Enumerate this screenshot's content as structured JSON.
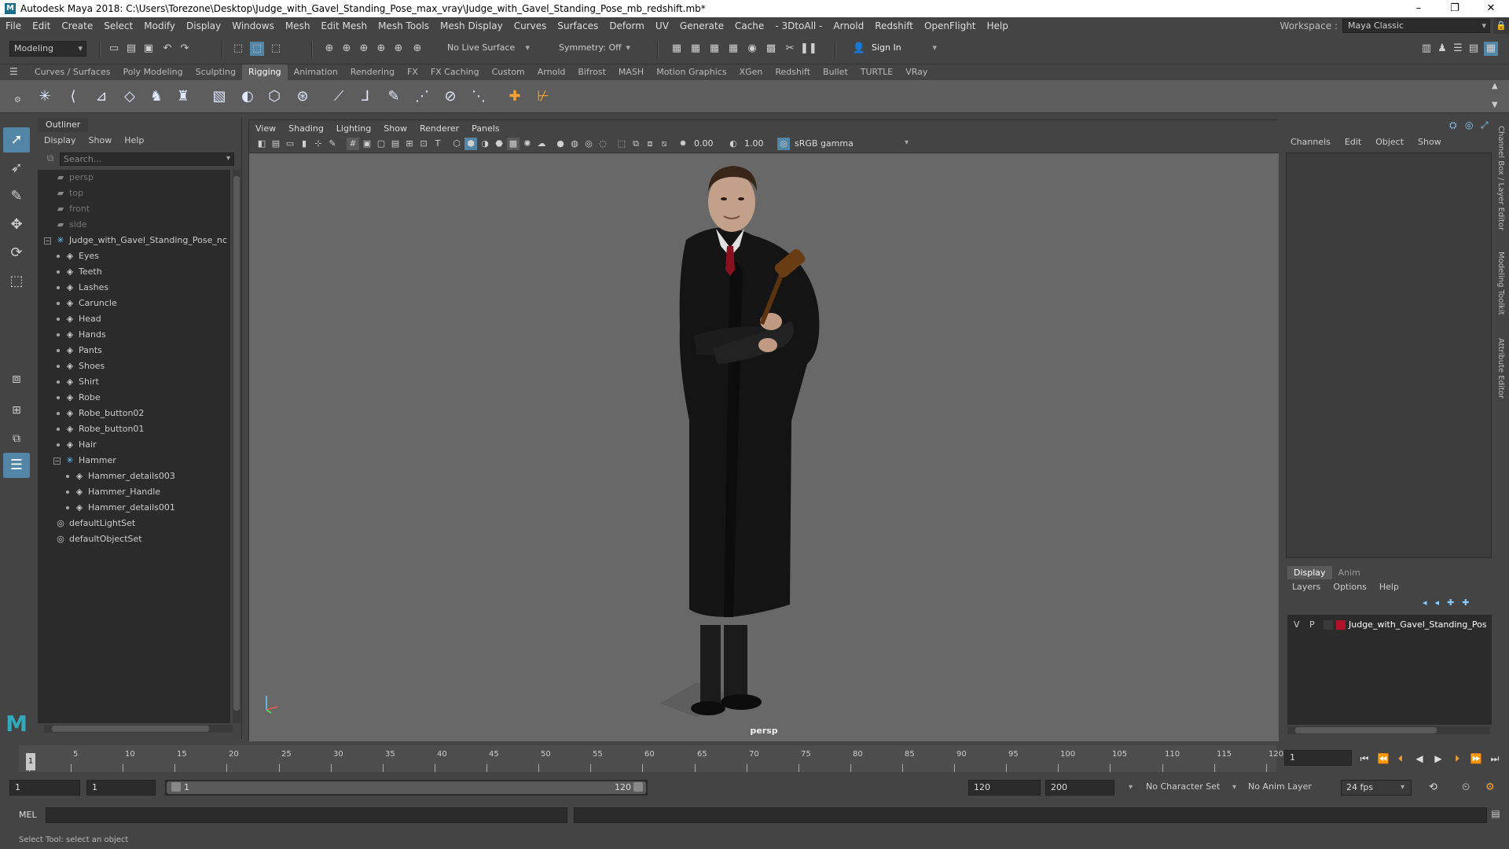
{
  "window": {
    "title": "Autodesk Maya 2018: C:\\Users\\Torezone\\Desktop\\Judge_with_Gavel_Standing_Pose_max_vray\\Judge_with_Gavel_Standing_Pose_mb_redshift.mb*",
    "logo": "M",
    "min": "–",
    "max": "❐",
    "close": "✕"
  },
  "menubar": {
    "items": [
      "File",
      "Edit",
      "Create",
      "Select",
      "Modify",
      "Display",
      "Windows",
      "Mesh",
      "Edit Mesh",
      "Mesh Tools",
      "Mesh Display",
      "Curves",
      "Surfaces",
      "Deform",
      "UV",
      "Generate",
      "Cache",
      "- 3DtoAll -",
      "Arnold",
      "Redshift",
      "OpenFlight",
      "Help"
    ],
    "workspace_label": "Workspace :",
    "workspace_value": "Maya Classic",
    "lock_icon": "🔒"
  },
  "statusline": {
    "mode": "Modeling",
    "live_surface": "No Live Surface",
    "symmetry": "Symmetry: Off",
    "sign_in": "Sign In"
  },
  "shelf": {
    "tabs": [
      "Curves / Surfaces",
      "Poly Modeling",
      "Sculpting",
      "Rigging",
      "Animation",
      "Rendering",
      "FX",
      "FX Caching",
      "Custom",
      "Arnold",
      "Bifrost",
      "MASH",
      "Motion Graphics",
      "XGen",
      "Redshift",
      "Bullet",
      "TURTLE",
      "VRay"
    ],
    "active_tab": "Rigging"
  },
  "outliner": {
    "title": "Outliner",
    "menu": [
      "Display",
      "Show",
      "Help"
    ],
    "search_placeholder": "Search...",
    "rows": [
      {
        "label": "persp",
        "indent": 0,
        "type": "camera",
        "dim": true
      },
      {
        "label": "top",
        "indent": 0,
        "type": "camera",
        "dim": true
      },
      {
        "label": "front",
        "indent": 0,
        "type": "camera",
        "dim": true
      },
      {
        "label": "side",
        "indent": 0,
        "type": "camera",
        "dim": true
      },
      {
        "label": "Judge_with_Gavel_Standing_Pose_nc",
        "indent": 0,
        "type": "joint",
        "expand": "−"
      },
      {
        "label": "Eyes",
        "indent": 1,
        "type": "mesh"
      },
      {
        "label": "Teeth",
        "indent": 1,
        "type": "mesh"
      },
      {
        "label": "Lashes",
        "indent": 1,
        "type": "mesh"
      },
      {
        "label": "Caruncle",
        "indent": 1,
        "type": "mesh"
      },
      {
        "label": "Head",
        "indent": 1,
        "type": "mesh"
      },
      {
        "label": "Hands",
        "indent": 1,
        "type": "mesh"
      },
      {
        "label": "Pants",
        "indent": 1,
        "type": "mesh"
      },
      {
        "label": "Shoes",
        "indent": 1,
        "type": "mesh"
      },
      {
        "label": "Shirt",
        "indent": 1,
        "type": "mesh"
      },
      {
        "label": "Robe",
        "indent": 1,
        "type": "mesh"
      },
      {
        "label": "Robe_button02",
        "indent": 1,
        "type": "mesh"
      },
      {
        "label": "Robe_button01",
        "indent": 1,
        "type": "mesh"
      },
      {
        "label": "Hair",
        "indent": 1,
        "type": "mesh"
      },
      {
        "label": "Hammer",
        "indent": 1,
        "type": "joint",
        "expand": "−"
      },
      {
        "label": "Hammer_details003",
        "indent": 2,
        "type": "mesh"
      },
      {
        "label": "Hammer_Handle",
        "indent": 2,
        "type": "mesh"
      },
      {
        "label": "Hammer_details001",
        "indent": 2,
        "type": "mesh"
      },
      {
        "label": "defaultLightSet",
        "indent": 0,
        "type": "set"
      },
      {
        "label": "defaultObjectSet",
        "indent": 0,
        "type": "set"
      }
    ]
  },
  "viewport": {
    "menu": [
      "View",
      "Shading",
      "Lighting",
      "Show",
      "Renderer",
      "Panels"
    ],
    "exposure": "0.00",
    "gamma": "1.00",
    "color_space": "sRGB gamma",
    "camera_label": "persp"
  },
  "channelbox": {
    "menu": [
      "Channels",
      "Edit",
      "Object",
      "Show"
    ],
    "layer_tabs": [
      "Display",
      "Anim"
    ],
    "layer_menu": [
      "Layers",
      "Options",
      "Help"
    ],
    "layer_row": {
      "v": "V",
      "p": "P",
      "name": "Judge_with_Gavel_Standing_Pos",
      "color": "#b0102a"
    }
  },
  "side_tabs": [
    "Channel Box / Layer Editor",
    "Modeling Toolkit",
    "Attribute Editor"
  ],
  "timeline": {
    "ticks": [
      1,
      5,
      10,
      15,
      20,
      25,
      30,
      35,
      40,
      45,
      50,
      55,
      60,
      65,
      70,
      75,
      80,
      85,
      90,
      95,
      100,
      105,
      110,
      115,
      120
    ],
    "current_frame": "1",
    "current_marker": "1"
  },
  "range": {
    "start": "1",
    "playback_start": "1",
    "slider_start": "1",
    "slider_end": "120",
    "playback_end": "120",
    "end": "200",
    "character_set": "No Character Set",
    "anim_layer": "No Anim Layer",
    "fps": "24 fps"
  },
  "cmd": {
    "lang": "MEL"
  },
  "help_line": "Select Tool: select an object"
}
